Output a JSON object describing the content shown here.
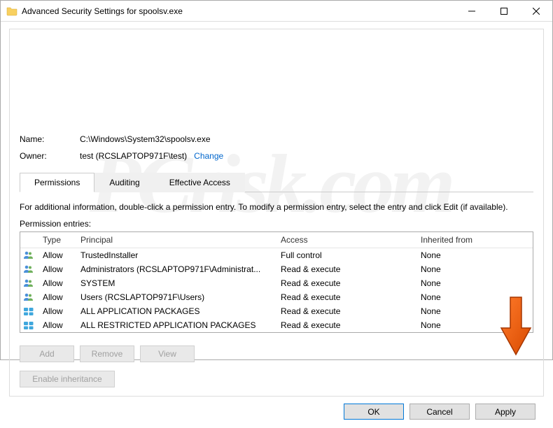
{
  "window": {
    "title": "Advanced Security Settings for spoolsv.exe"
  },
  "fields": {
    "name_label": "Name:",
    "name_value": "C:\\Windows\\System32\\spoolsv.exe",
    "owner_label": "Owner:",
    "owner_value": "test (RCSLAPTOP971F\\test)",
    "change_link": "Change"
  },
  "tabs": {
    "permissions": "Permissions",
    "auditing": "Auditing",
    "effective": "Effective Access"
  },
  "info_text": "For additional information, double-click a permission entry. To modify a permission entry, select the entry and click Edit (if available).",
  "entries_label": "Permission entries:",
  "columns": {
    "type": "Type",
    "principal": "Principal",
    "access": "Access",
    "inherited": "Inherited from"
  },
  "rows": [
    {
      "icon": "users",
      "type": "Allow",
      "principal": "TrustedInstaller",
      "access": "Full control",
      "inherited": "None"
    },
    {
      "icon": "users",
      "type": "Allow",
      "principal": "Administrators (RCSLAPTOP971F\\Administrat...",
      "access": "Read & execute",
      "inherited": "None"
    },
    {
      "icon": "users",
      "type": "Allow",
      "principal": "SYSTEM",
      "access": "Read & execute",
      "inherited": "None"
    },
    {
      "icon": "users",
      "type": "Allow",
      "principal": "Users (RCSLAPTOP971F\\Users)",
      "access": "Read & execute",
      "inherited": "None"
    },
    {
      "icon": "app",
      "type": "Allow",
      "principal": "ALL APPLICATION PACKAGES",
      "access": "Read & execute",
      "inherited": "None"
    },
    {
      "icon": "app",
      "type": "Allow",
      "principal": "ALL RESTRICTED APPLICATION PACKAGES",
      "access": "Read & execute",
      "inherited": "None"
    }
  ],
  "buttons": {
    "add": "Add",
    "remove": "Remove",
    "view": "View",
    "enable_inherit": "Enable inheritance",
    "ok": "OK",
    "cancel": "Cancel",
    "apply": "Apply"
  },
  "watermark": "PCrisk.com"
}
